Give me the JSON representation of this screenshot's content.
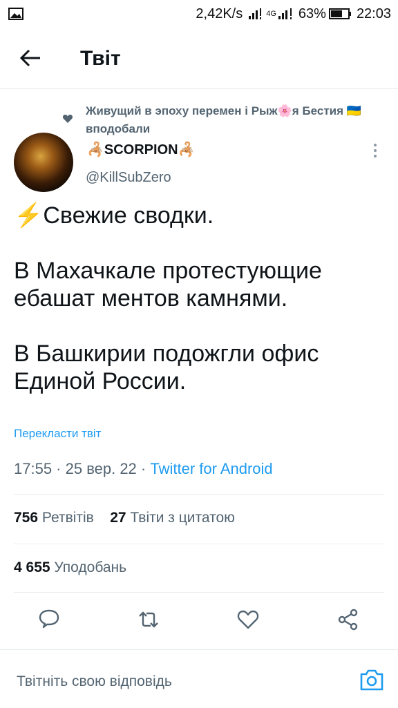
{
  "status_bar": {
    "speed": "2,42K/s",
    "network": "4G",
    "battery": "63%",
    "time": "22:03"
  },
  "header": {
    "title": "Твіт"
  },
  "social_context": {
    "text": "Живущий в эпоху перемен і Рыж🌸я Бестия 🇺🇦 вподобали"
  },
  "author": {
    "display_name": "🦂SCORPION🦂",
    "handle": "@KillSubZero"
  },
  "tweet": {
    "text": "⚡Свежие сводки.\n\nВ Махачкале протестующие ебашат ментов камнями.\n\nВ Башкирии подожгли офис Единой России.",
    "translate_label": "Перекласти твіт",
    "time_date": "17:55 · 25 вер. 22 · ",
    "source": "Twitter for Android"
  },
  "stats": {
    "retweets_count": "756",
    "retweets_label": "Ретвітів",
    "quotes_count": "27",
    "quotes_label": "Твіти з цитатою",
    "likes_count": "4 655",
    "likes_label": "Уподобань"
  },
  "reply": {
    "placeholder": "Твітніть свою відповідь"
  },
  "colors": {
    "accent": "#1d9bf0",
    "secondary_text": "#536471",
    "text": "#0f1419"
  },
  "icons": [
    "image-icon",
    "signal-icon",
    "battery-icon",
    "back-arrow-icon",
    "heart-icon",
    "more-icon",
    "reply-icon",
    "retweet-icon",
    "like-icon",
    "share-icon",
    "camera-icon"
  ]
}
